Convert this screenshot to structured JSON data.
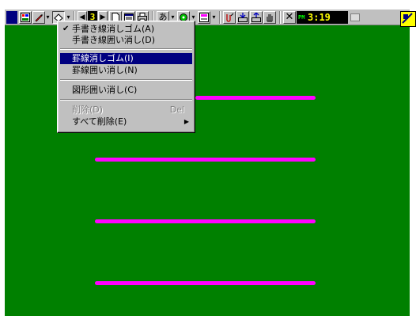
{
  "menu": {
    "items": [
      {
        "label": "手書き線消しゴム(A)",
        "checked": true
      },
      {
        "label": "手書き線囲い消し(D)"
      },
      {
        "label": "罫線消しゴム(I)",
        "selected": true
      },
      {
        "label": "罫線囲い消し(N)"
      },
      {
        "label": "図形囲い消し(C)"
      },
      {
        "label": "削除(D)",
        "shortcut": "Del",
        "disabled": true
      },
      {
        "label": "すべて削除(E)",
        "submenu": true
      }
    ]
  },
  "toolbar": {
    "page_indicator": "3",
    "char_button": "あ",
    "check_mark": "✔",
    "clock": {
      "ampm": "PM",
      "time": "3:19"
    },
    "icons": [
      "window-icon",
      "pen-icon",
      "eraser-icon",
      "prev-page-icon",
      "next-page-icon",
      "new-page-icon",
      "page-list-icon",
      "print-icon",
      "text-input-icon",
      "stamp-icon",
      "frame-icon",
      "clip-icon",
      "import-icon",
      "export-icon",
      "hand-icon",
      "close-x-icon"
    ]
  },
  "colors": {
    "desk": "#008000",
    "ruled_line": "#ff00ff",
    "menu_highlight": "#000080",
    "toolbar": "#c0c0c0"
  }
}
